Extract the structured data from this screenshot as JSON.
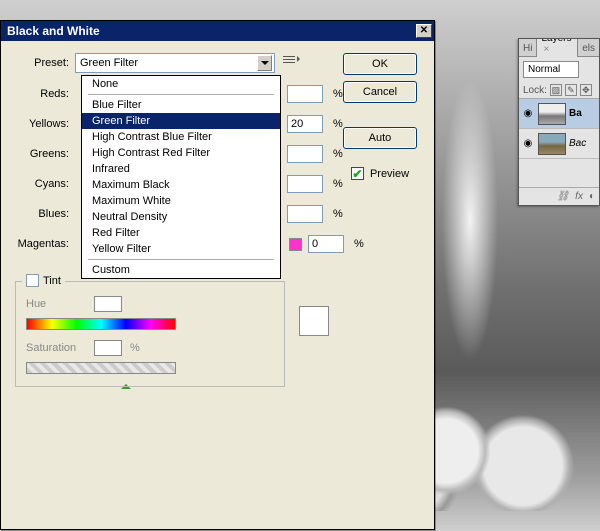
{
  "dialog": {
    "title": "Black and White",
    "preset_label": "Preset:",
    "selected_preset": "Green Filter",
    "buttons": {
      "ok": "OK",
      "cancel": "Cancel",
      "auto": "Auto"
    },
    "preview_label": "Preview",
    "preview_checked": true,
    "channels": [
      {
        "name": "Reds:",
        "value": "",
        "unit": "%"
      },
      {
        "name": "Yellows:",
        "value": "20",
        "unit": "%"
      },
      {
        "name": "Greens:",
        "value": "",
        "unit": "%"
      },
      {
        "name": "Cyans:",
        "value": "",
        "unit": "%"
      },
      {
        "name": "Blues:",
        "value": "",
        "unit": "%"
      },
      {
        "name": "Magentas:",
        "value": "0",
        "unit": "%",
        "swatch": "#ff33cc"
      }
    ],
    "preset_options": [
      "None",
      "Blue Filter",
      "Green Filter",
      "High Contrast Blue Filter",
      "High Contrast Red Filter",
      "Infrared",
      "Maximum Black",
      "Maximum White",
      "Neutral Density",
      "Red Filter",
      "Yellow Filter",
      "Custom"
    ],
    "tint": {
      "label": "Tint",
      "hue_label": "Hue",
      "sat_label": "Saturation",
      "hue_value": "",
      "sat_value": "",
      "sat_unit": "%"
    }
  },
  "layers": {
    "tab_h": "Hi",
    "tab_layers": "Layers",
    "tab_extra": "els",
    "blend_mode": "Normal",
    "lock_label": "Lock:",
    "rows": [
      {
        "name": "Ba",
        "active": true
      },
      {
        "name": "Bac",
        "active": false
      }
    ],
    "footer_fx": "fx"
  }
}
